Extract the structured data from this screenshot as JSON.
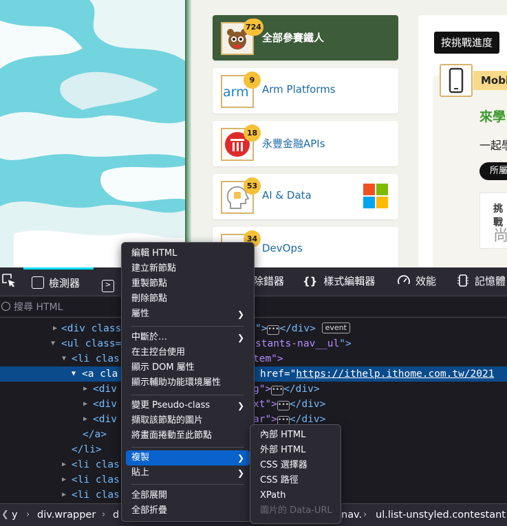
{
  "contest_list": [
    {
      "name": "全部參賽鐵人",
      "count": "724",
      "icon": "mascot-icon",
      "active": true
    },
    {
      "name": "Arm Platforms",
      "count": "9",
      "icon": "arm-logo-icon",
      "active": false
    },
    {
      "name": "永豐金融APIs",
      "count": "18",
      "icon": "sinopac-logo-icon",
      "active": false
    },
    {
      "name": "AI & Data",
      "count": "53",
      "icon": "ai-head-icon",
      "active": false
    },
    {
      "name": "DevOps",
      "count": "34",
      "icon": "devops-icon",
      "active": false
    }
  ],
  "side_panel": {
    "challenge_button": "按挑戰進度",
    "category_label": "Mobi",
    "learn_title": "來學",
    "learn_sub": "一起學",
    "all_pill": "所屬",
    "stat_label": "挑戰",
    "stat_value": "尚"
  },
  "devtools": {
    "tabs": {
      "inspector": "檢測器",
      "debugger": "除錯器",
      "style_editor": "樣式編輯器",
      "performance": "效能",
      "memory": "記憶體"
    },
    "search_placeholder": "搜尋 HTML",
    "tree": {
      "r1_tag": "<div class",
      "r1_tail": "\">",
      "r1_close": "</div>",
      "r1_event": "event",
      "r2_tag": "<ul class=",
      "r2_val": "stants-nav__ul",
      "r2_close": "\">",
      "r3_tag": "<li clas",
      "r3_val": "tem\">",
      "r4_tag": "<a cla",
      "r4_attr": "href=",
      "r4_url": "https://ithelp.ithome.com.tw/2021",
      "r5_tag": "<div",
      "r5_val": "g\">",
      "r5_close": "</div>",
      "r6_tag": "<div",
      "r6_val": "xt\">",
      "r6_close": "</div>",
      "r7_tag": "<div",
      "r7_val": "ar\">",
      "r7_close": "</div>",
      "r8": "</a>",
      "r9": "</li>",
      "r10": "<li clas",
      "r11": "<li clas",
      "r12": "<li clas",
      "dots": "•••"
    },
    "breadcrumbs": {
      "first": "y",
      "second": "div.wrapper",
      "third": "d",
      "fourth": "nav.",
      "fifth": "ul.list-unstyled.contestant"
    }
  },
  "context_menu": {
    "edit_html": "編輯 HTML",
    "create_node": "建立新節點",
    "duplicate_node": "重製節點",
    "delete_node": "刪除節點",
    "attributes": "屬性",
    "break_on": "中斷於…",
    "use_in_console": "在主控台使用",
    "show_dom_props": "顯示 DOM 屬性",
    "show_a11y_props": "顯示輔助功能環境屬性",
    "change_pseudo": "變更 Pseudo-class",
    "screenshot_node": "擷取該節點的圖片",
    "scroll_into_view": "將畫面捲動至此節點",
    "copy": "複製",
    "paste": "貼上",
    "expand_all": "全部展開",
    "collapse_all": "全部折疊"
  },
  "copy_submenu": {
    "inner_html": "內部 HTML",
    "outer_html": "外部 HTML",
    "css_selector": "CSS 選擇器",
    "css_path": "CSS 路徑",
    "xpath": "XPath",
    "data_url": "圖片的 Data-URL"
  },
  "colors": {
    "accent_green": "#3d5c3a",
    "badge_yellow": "#f6c038",
    "link_blue": "#1a6aa6",
    "menu_highlight": "#0a63cc",
    "devtools_bg": "#1c1b22"
  }
}
